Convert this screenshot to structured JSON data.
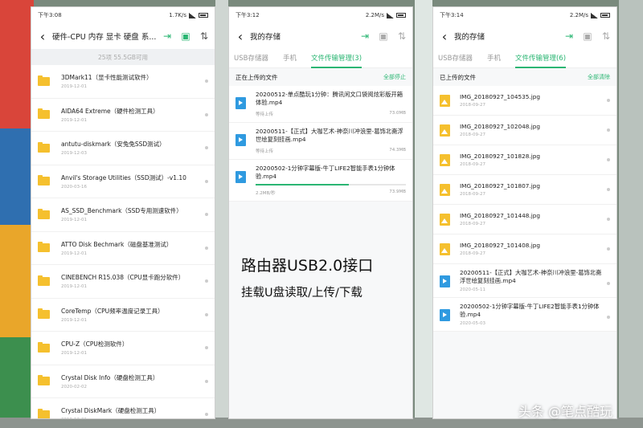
{
  "phone1": {
    "status": {
      "time": "下午3:08",
      "speed": "1.7K/s"
    },
    "title": "硬件-CPU 内存 显卡 硬盘 系...",
    "storage_info": "25项 55.5GB可用",
    "files": [
      {
        "name": "3DMark11（显卡性能测试软件）",
        "date": "2019-12-01"
      },
      {
        "name": "AIDA64 Extreme（硬件检测工具）",
        "date": "2019-12-01"
      },
      {
        "name": "antutu-diskmark（安兔兔SSD测试）",
        "date": "2019-12-03"
      },
      {
        "name": "Anvil's Storage Utilities（SSD测试）-v1.10",
        "date": "2020-03-16"
      },
      {
        "name": "AS_SSD_Benchmark（SSD专用测速软件）",
        "date": "2019-12-01"
      },
      {
        "name": "ATTO Disk Bechmark（磁盘基准测试）",
        "date": "2019-12-01"
      },
      {
        "name": "CINEBENCH R15.038（CPU显卡跑分软件）",
        "date": "2019-12-01"
      },
      {
        "name": "CoreTemp（CPU频率温度记录工具）",
        "date": "2019-12-01"
      },
      {
        "name": "CPU-Z（CPU检测软件）",
        "date": "2019-12-01"
      },
      {
        "name": "Crystal Disk Info（硬盘检测工具）",
        "date": "2020-02-02"
      },
      {
        "name": "Crystal DiskMark（硬盘检测工具）",
        "date": "2019-12-01"
      }
    ]
  },
  "phone2": {
    "status": {
      "time": "下午3:12",
      "speed": "2.2M/s"
    },
    "title": "我的存储",
    "tabs": [
      "USB存储器",
      "手机",
      "文件传输管理(3)"
    ],
    "section_title": "正在上传的文件",
    "section_action": "全部停止",
    "uploads": [
      {
        "name": "20200512-单点酷玩1分钟：腾讯闲文口袋阅炫彩版开箱体验.mp4",
        "status": "等待上传",
        "size": "73.0MB",
        "progress": null
      },
      {
        "name": "20200511-【正式】大咖艺术-神奈川冲浪里-葛饰北斋浮世绘复刻挂画.mp4",
        "status": "等待上传",
        "size": "74.3MB",
        "progress": null
      },
      {
        "name": "20200502-1分钟字幕版-牛丁LIFE2智能手表1分钟体验.mp4",
        "status": "2.2MB/秒",
        "size": "73.9MB",
        "progress": 0.62
      }
    ]
  },
  "phone3": {
    "status": {
      "time": "下午3:14",
      "speed": "2.2M/s"
    },
    "title": "我的存储",
    "tabs": [
      "USB存储器",
      "手机",
      "文件传输管理(6)"
    ],
    "section_title": "已上传的文件",
    "section_action": "全部清除",
    "images": [
      {
        "name": "IMG_20180927_104535.jpg",
        "date": "2018-09-27"
      },
      {
        "name": "IMG_20180927_102048.jpg",
        "date": "2018-09-27"
      },
      {
        "name": "IMG_20180927_101828.jpg",
        "date": "2018-09-27"
      },
      {
        "name": "IMG_20180927_101807.jpg",
        "date": "2018-09-27"
      },
      {
        "name": "IMG_20180927_101448.jpg",
        "date": "2018-09-27"
      },
      {
        "name": "IMG_20180927_101408.jpg",
        "date": "2018-09-27"
      }
    ],
    "videos": [
      {
        "name": "20200511-【正式】大咖艺术-神奈川冲浪里-葛饰北斋浮世绘复刻挂画.mp4",
        "date": "2020-05-11"
      },
      {
        "name": "20200502-1分钟字幕版-牛丁LIFE2智能手表1分钟体验.mp4",
        "date": "2020-05-03"
      }
    ]
  },
  "caption": {
    "line1": "路由器USB2.0接口",
    "line2": "挂载U盘读取/上传/下载"
  },
  "watermark": "头条 @笔点酷玩",
  "colors": {
    "accent": "#2bb673",
    "folder": "#f5c02e",
    "video": "#2f9ae0"
  }
}
